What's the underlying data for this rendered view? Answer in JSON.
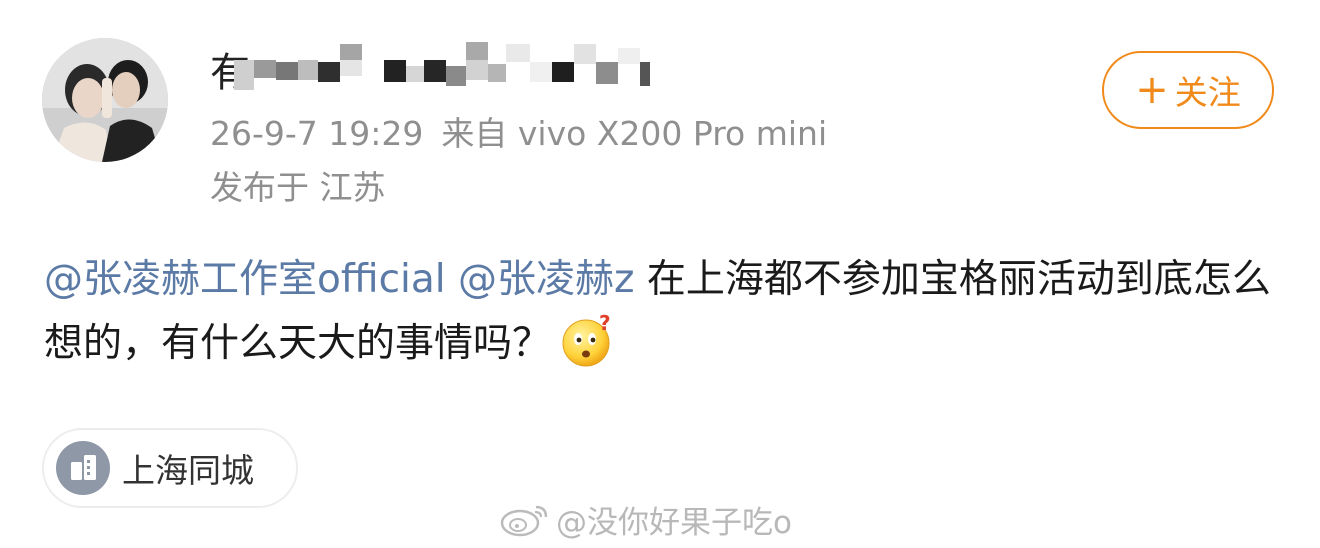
{
  "post": {
    "author": {
      "name_visible": "有",
      "name_obscured": true
    },
    "timestamp": "26-9-7 19:29",
    "source": "来自 vivo X200 Pro mini",
    "location": "发布于 江苏",
    "follow_label": "关注",
    "follow_plus": "+",
    "content": {
      "mention_1": "@张凌赫工作室official",
      "mention_2": "@张凌赫z",
      "text": "在上海都不参加宝格丽活动到底怎么想的，有什么天大的事情吗？"
    },
    "emoji_name": "confused-face-emoji",
    "topic_chip": {
      "label": "上海同城",
      "icon": "building-icon"
    }
  },
  "watermark": {
    "text": "@没你好果子吃o",
    "icon": "weibo-logo-icon"
  },
  "colors": {
    "accent": "#f08a1b",
    "mention": "#5b7aa6",
    "meta": "#8f8f8f",
    "chip_icon_bg": "#8e98a6"
  }
}
